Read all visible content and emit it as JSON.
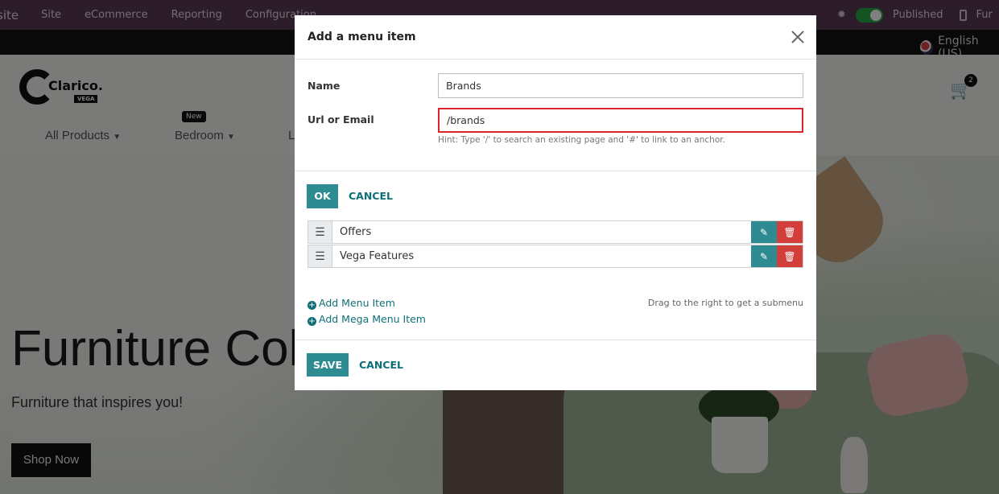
{
  "topbar": {
    "app_fragment": "site",
    "menu": [
      "Site",
      "eCommerce",
      "Reporting",
      "Configuration"
    ],
    "published_label": "Published",
    "right_fragment": "Fur"
  },
  "langbar": {
    "language": "English (US)"
  },
  "header": {
    "logo_text": "Clarico.",
    "logo_sub": "VEGA",
    "nav": [
      "All Products",
      "Bedroom",
      "L"
    ],
    "nav_badge": "New",
    "cart_count": "2"
  },
  "hero": {
    "title": "Furniture Col",
    "subtitle": "Furniture that inspires you!",
    "button": "Shop Now"
  },
  "menu_editor": {
    "rows": [
      {
        "label": "Offers"
      },
      {
        "label": "Vega Features"
      }
    ],
    "add_menu_item": "Add Menu Item",
    "add_mega_menu_item": "Add Mega Menu Item",
    "drag_hint": "Drag to the right to get a submenu",
    "save_label": "SAVE",
    "cancel_label": "CANCEL"
  },
  "add_item_dialog": {
    "title": "Add a menu item",
    "name_label": "Name",
    "name_value": "Brands",
    "url_label": "Url or Email",
    "url_value": "/brands",
    "hint": "Hint: Type '/' to search an existing page and '#' to link to an anchor.",
    "ok_label": "OK",
    "cancel_label": "CANCEL"
  },
  "colors": {
    "accent": "#2e8b92",
    "danger": "#d23f3a",
    "highlight_border": "#d9232d",
    "topbar": "#5a3a56"
  }
}
